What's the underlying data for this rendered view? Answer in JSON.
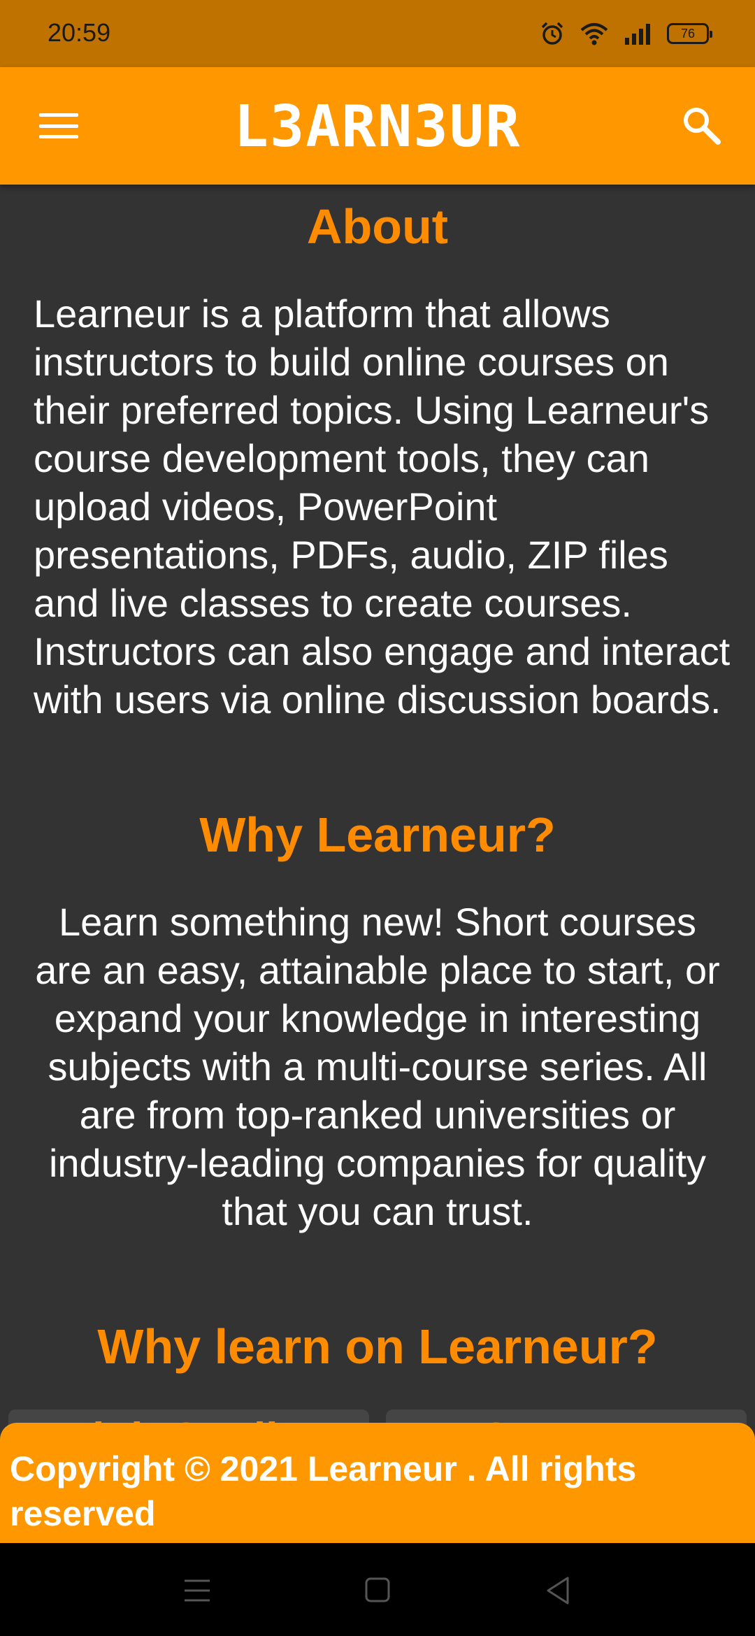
{
  "status_bar": {
    "time": "20:59",
    "battery_level": "76",
    "icons": [
      "alarm-icon",
      "wifi-icon",
      "signal-icon",
      "battery-icon"
    ]
  },
  "app_bar": {
    "logo_text": "L3ARN3UR",
    "menu_icon": "hamburger-menu-icon",
    "search_icon": "search-icon",
    "background": "#FF9800"
  },
  "about": {
    "title": "About",
    "text": "Learneur is a platform that allows instructors to build online courses on their preferred topics. Using Learneur's course development tools, they can upload videos, PowerPoint presentations, PDFs, audio, ZIP files and live classes to create courses. Instructors can also engage and interact with users via online discussion boards."
  },
  "why": {
    "title": "Why Learneur?",
    "text": "Learn something new! Short courses are an easy, attainable place to start, or expand your knowledge in interesting subjects with a multi-course series. All are from top-ranked universities or industry-leading companies for quality that you can trust."
  },
  "why_learn": {
    "title": "Why learn on Learneur?",
    "cards": [
      {
        "title": "High Quality"
      },
      {
        "title": "Courses"
      }
    ]
  },
  "footer": {
    "text": "Copyright © 2021 Learneur . All rights reserved"
  },
  "colors": {
    "accent": "#FF8C00",
    "status_bar": "#BF7200",
    "background": "#333333"
  },
  "nav_bar": {
    "buttons": [
      "recent-apps-icon",
      "home-icon",
      "back-icon"
    ]
  }
}
